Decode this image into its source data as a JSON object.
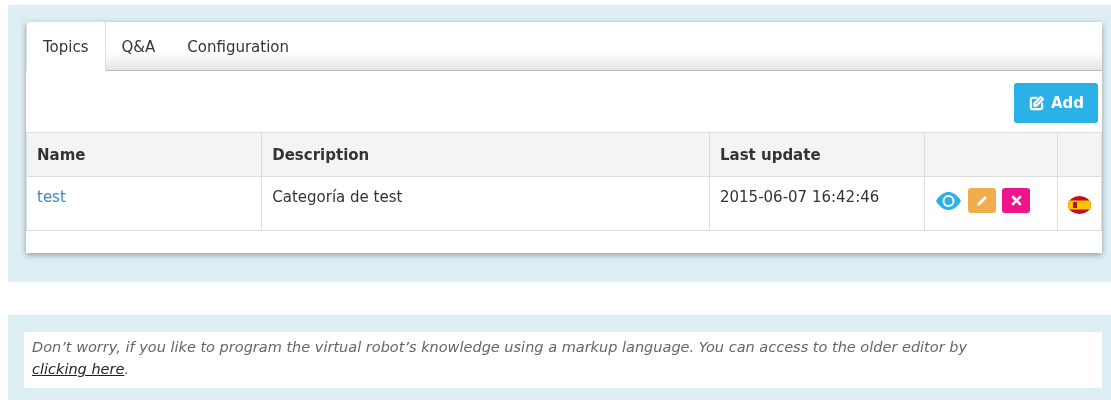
{
  "tabs": [
    {
      "label": "Topics",
      "selected": true
    },
    {
      "label": "Q&A",
      "selected": false
    },
    {
      "label": "Configuration",
      "selected": false
    }
  ],
  "add_button": {
    "label": "Add"
  },
  "table": {
    "columns": [
      "Name",
      "Description",
      "Last update",
      "",
      ""
    ],
    "rows": [
      {
        "name": "test",
        "description": "Categoría de test",
        "last_update": "2015-06-07 16:42:46"
      }
    ]
  },
  "note": {
    "text": "Don’t worry, if you like to program the virtual robot’s knowledge using a markup language. You can access to the older editor by ",
    "link": "clicking here",
    "end": "."
  }
}
